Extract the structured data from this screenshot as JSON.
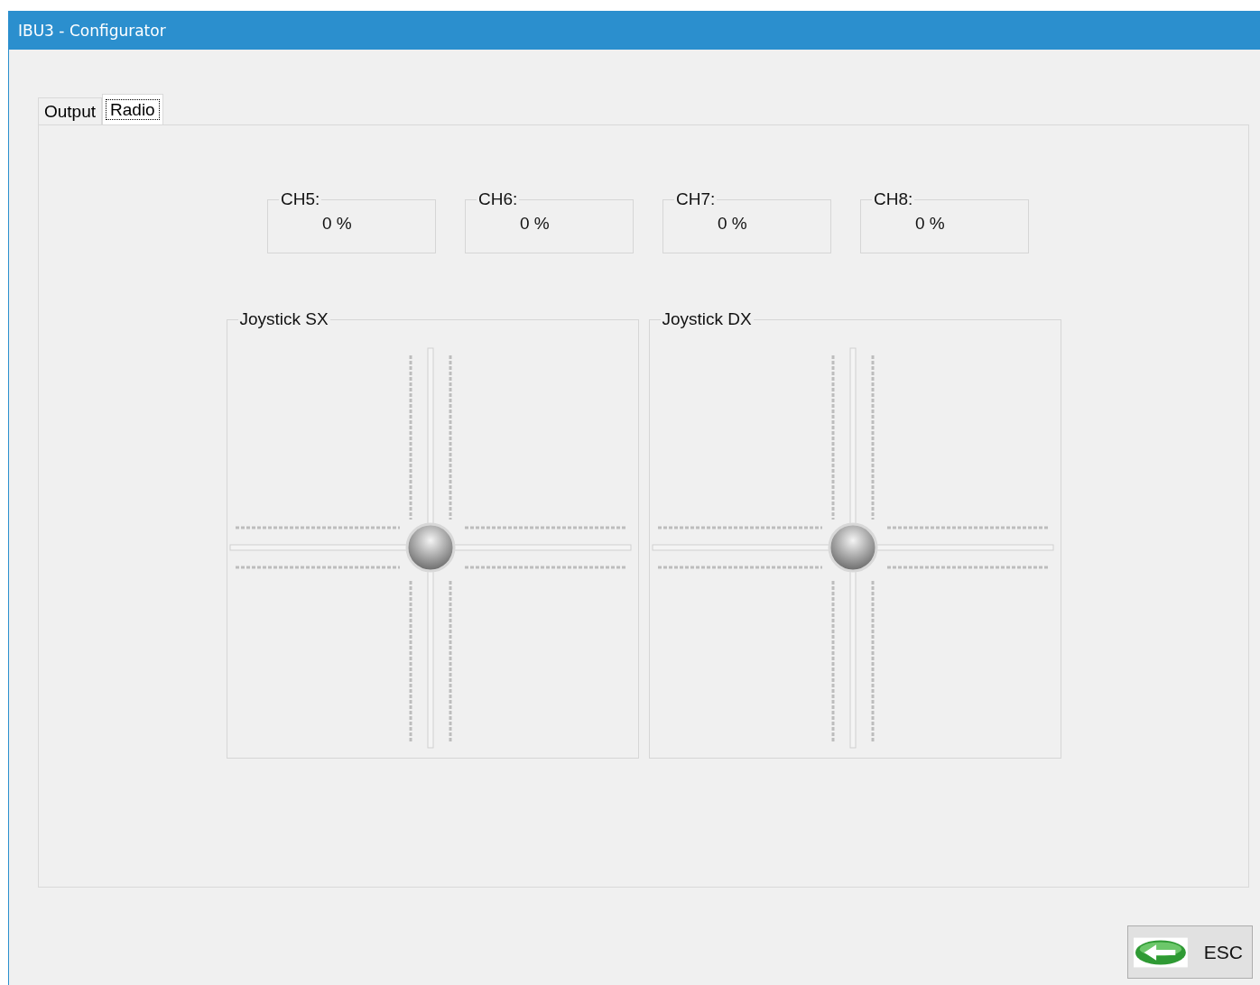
{
  "window": {
    "title": "IBU3 - Configurator"
  },
  "tabs": [
    {
      "label": "Output",
      "selected": false
    },
    {
      "label": "Radio",
      "selected": true
    }
  ],
  "channels": [
    {
      "label": "CH5:",
      "value": "0 %"
    },
    {
      "label": "CH6:",
      "value": "0 %"
    },
    {
      "label": "CH7:",
      "value": "0 %"
    },
    {
      "label": "CH8:",
      "value": "0 %"
    }
  ],
  "joysticks": [
    {
      "label": "Joystick SX"
    },
    {
      "label": "Joystick DX"
    }
  ],
  "buttons": [
    {
      "kind": "back",
      "label": "ESC"
    }
  ]
}
